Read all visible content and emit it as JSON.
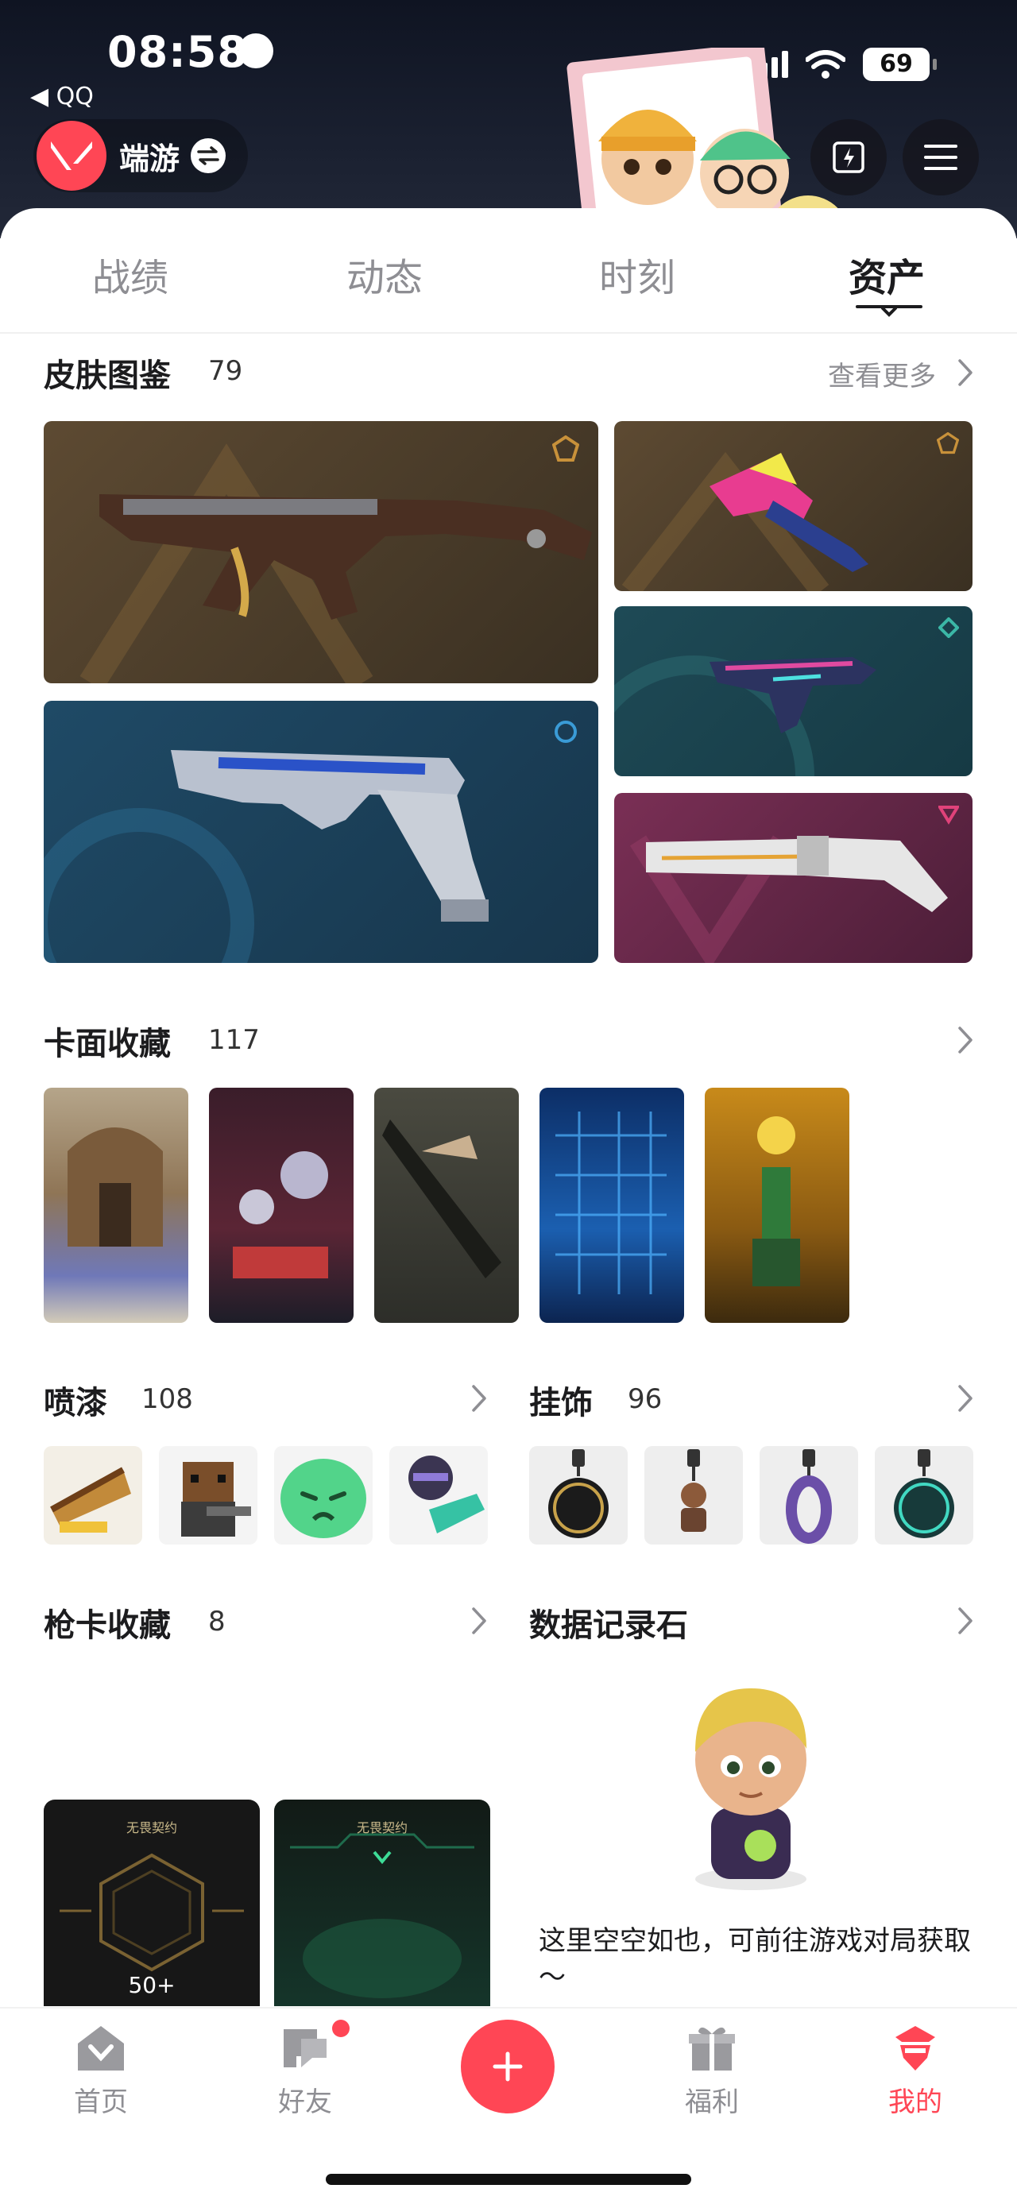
{
  "status_bar": {
    "time": "08:58",
    "back_app": "◀ QQ",
    "battery": "69"
  },
  "header": {
    "game_name": "端游"
  },
  "tabs": [
    {
      "label": "战绩",
      "active": false
    },
    {
      "label": "动态",
      "active": false
    },
    {
      "label": "时刻",
      "active": false
    },
    {
      "label": "资产",
      "active": true
    }
  ],
  "skins": {
    "title": "皮肤图鉴",
    "count": "79",
    "more": "查看更多"
  },
  "cards": {
    "title": "卡面收藏",
    "count": "117"
  },
  "sprays": {
    "title": "喷漆",
    "count": "108"
  },
  "buddies": {
    "title": "挂饰",
    "count": "96"
  },
  "gun_cards": {
    "title": "枪卡收藏",
    "count": "8",
    "tiles": [
      {
        "label": "无畏契约",
        "badge": "50+"
      },
      {
        "label": "无畏契约",
        "badge": ""
      }
    ]
  },
  "data_stone": {
    "title": "数据记录石",
    "empty_text": "这里空空如也，可前往游戏对局获取～"
  },
  "bottom_nav": [
    {
      "label": "首页",
      "active": false
    },
    {
      "label": "好友",
      "active": false,
      "badge": true
    },
    {
      "label": "福利",
      "active": false
    },
    {
      "label": "我的",
      "active": true
    }
  ],
  "colors": {
    "accent": "#ff4655",
    "gold_tier": "#c8913a",
    "teal_tier": "#3bb7a6",
    "blue_tier": "#3a9bd6",
    "pink_tier": "#e0427a"
  }
}
